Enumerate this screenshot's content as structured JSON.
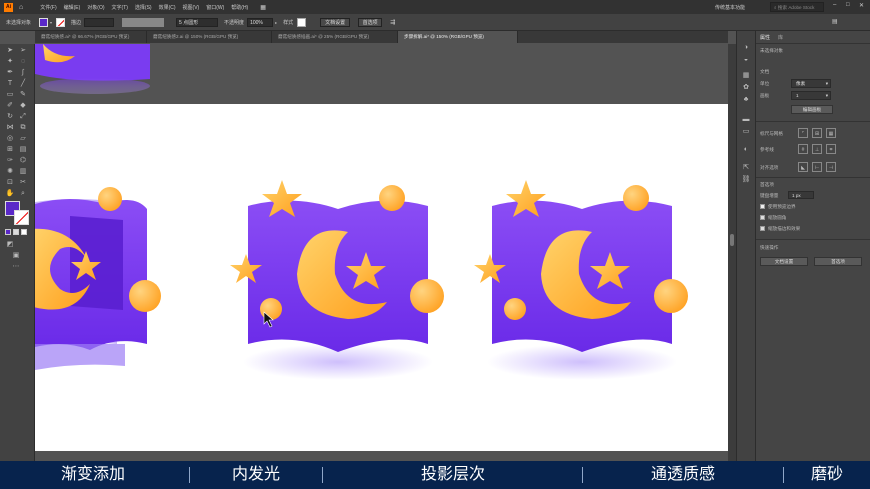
{
  "menu": {
    "items": [
      "文件(F)",
      "编辑(E)",
      "对象(O)",
      "文字(T)",
      "选择(S)",
      "效果(C)",
      "视图(V)",
      "窗口(W)",
      "帮助(H)"
    ],
    "workspace": "传统基本功能",
    "search_placeholder": "搜索 Adobe Stock"
  },
  "control": {
    "selection": "未选择对象",
    "stroke_label": "描边",
    "brush": "5 点圆形",
    "opacity_label": "不透明度",
    "opacity": "100%",
    "style_label": "样式",
    "doc_setup": "文档设置",
    "prefs": "首选项"
  },
  "tabs": [
    {
      "label": "蘑菇纽质感.ai* @ 66.67% (RGB/GPU 预览)",
      "active": false
    },
    {
      "label": "蘑菇纽质感2.ai @ 150% (RGB/GPU 预览)",
      "active": false
    },
    {
      "label": "蘑菇纽质感插画.ai* @ 25% (RGB/GPU 预览)",
      "active": false
    },
    {
      "label": "步骤拆解.ai* @ 150% (RGB/GPU 预览)",
      "active": true
    }
  ],
  "panel": {
    "tab1": "属性",
    "tab2": "库",
    "no_selection": "未选择对象",
    "document": "文档",
    "units_label": "单位",
    "units": "像素",
    "artboard_label": "画板",
    "artboard": "1",
    "edit_artboard": "编辑画板",
    "ruler_grid": "标尺与网格",
    "guides": "参考线",
    "align": "对齐选项",
    "preferences": "首选项",
    "key_increment_label": "键盘增量",
    "key_increment": "1 px",
    "check1": "使用预览边界",
    "check2": "缩放圆角",
    "check3": "缩放描边和效果",
    "quick_actions": "快速操作",
    "doc_setup_btn": "文档设置",
    "prefs_btn": "首选项"
  },
  "footer": {
    "items": [
      "渐变添加",
      "内发光",
      "投影层次",
      "通透质感",
      "磨砂"
    ]
  },
  "colors": {
    "purple": "#7a3cf0",
    "yellow": "#ffb732",
    "footer_bg": "#07234d"
  }
}
